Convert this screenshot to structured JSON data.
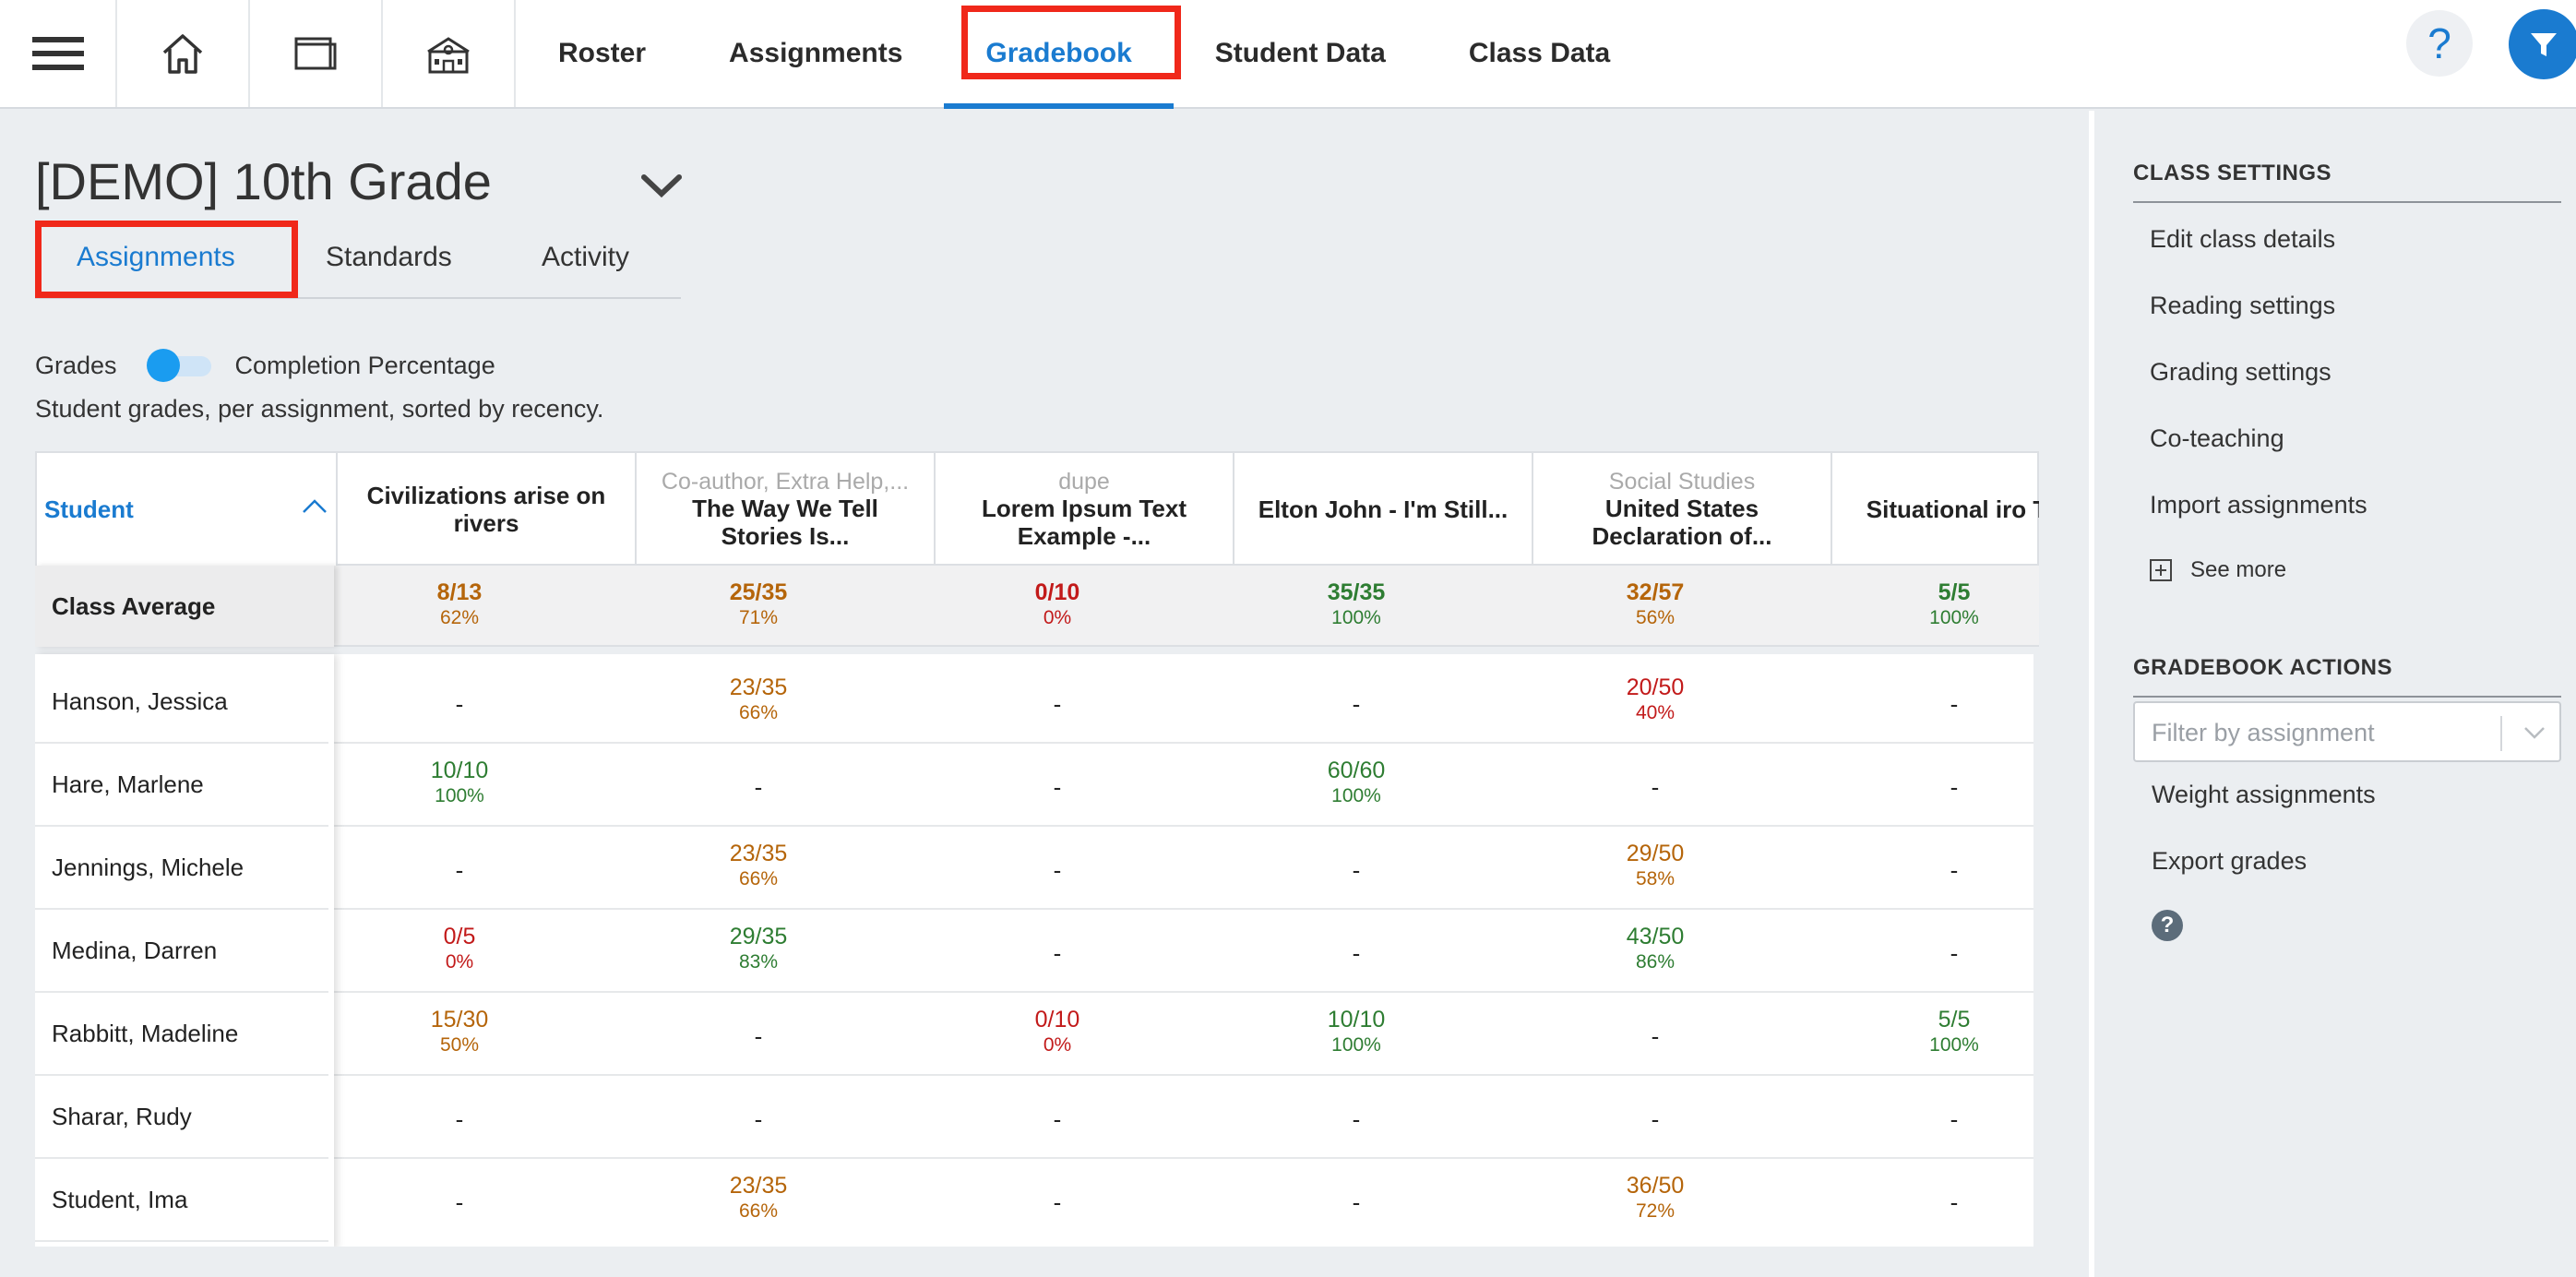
{
  "nav": {
    "links": [
      "Roster",
      "Assignments",
      "Gradebook",
      "Student Data",
      "Class Data"
    ],
    "active": "Gradebook",
    "help_label": "?"
  },
  "class": {
    "title": "[DEMO] 10th Grade",
    "tabs": [
      "Assignments",
      "Standards",
      "Activity"
    ],
    "active_tab": "Assignments"
  },
  "toggle": {
    "left_label": "Grades",
    "right_label": "Completion Percentage"
  },
  "description": "Student grades, per assignment, sorted by recency.",
  "table": {
    "student_header": "Student",
    "class_average_label": "Class Average",
    "columns": [
      {
        "category": "",
        "title": "Civilizations arise on rivers"
      },
      {
        "category": "Co-author, Extra Help,...",
        "title": "The Way We Tell Stories Is..."
      },
      {
        "category": "dupe",
        "title": "Lorem Ipsum Text Example -..."
      },
      {
        "category": "",
        "title": "Elton John - I'm Still..."
      },
      {
        "category": "Social Studies",
        "title": "United States Declaration of..."
      },
      {
        "category": "",
        "title": "Situational iro The..."
      }
    ],
    "averages": [
      {
        "score": "8/13",
        "pct": "62%",
        "color": "orange"
      },
      {
        "score": "25/35",
        "pct": "71%",
        "color": "orange"
      },
      {
        "score": "0/10",
        "pct": "0%",
        "color": "red"
      },
      {
        "score": "35/35",
        "pct": "100%",
        "color": "green"
      },
      {
        "score": "32/57",
        "pct": "56%",
        "color": "orange"
      },
      {
        "score": "5/5",
        "pct": "100%",
        "color": "green"
      }
    ],
    "rows": [
      {
        "name": "Hanson, Jessica",
        "cells": [
          {
            "score": "-"
          },
          {
            "score": "23/35",
            "pct": "66%",
            "color": "orange"
          },
          {
            "score": "-"
          },
          {
            "score": "-"
          },
          {
            "score": "20/50",
            "pct": "40%",
            "color": "red"
          },
          {
            "score": "-"
          }
        ]
      },
      {
        "name": "Hare, Marlene",
        "cells": [
          {
            "score": "10/10",
            "pct": "100%",
            "color": "green"
          },
          {
            "score": "-"
          },
          {
            "score": "-"
          },
          {
            "score": "60/60",
            "pct": "100%",
            "color": "green"
          },
          {
            "score": "-"
          },
          {
            "score": "-"
          }
        ]
      },
      {
        "name": "Jennings, Michele",
        "cells": [
          {
            "score": "-"
          },
          {
            "score": "23/35",
            "pct": "66%",
            "color": "orange"
          },
          {
            "score": "-"
          },
          {
            "score": "-"
          },
          {
            "score": "29/50",
            "pct": "58%",
            "color": "orange"
          },
          {
            "score": "-"
          }
        ]
      },
      {
        "name": "Medina, Darren",
        "cells": [
          {
            "score": "0/5",
            "pct": "0%",
            "color": "red"
          },
          {
            "score": "29/35",
            "pct": "83%",
            "color": "green"
          },
          {
            "score": "-"
          },
          {
            "score": "-"
          },
          {
            "score": "43/50",
            "pct": "86%",
            "color": "green"
          },
          {
            "score": "-"
          }
        ]
      },
      {
        "name": "Rabbitt, Madeline",
        "cells": [
          {
            "score": "15/30",
            "pct": "50%",
            "color": "orange"
          },
          {
            "score": "-"
          },
          {
            "score": "0/10",
            "pct": "0%",
            "color": "red"
          },
          {
            "score": "10/10",
            "pct": "100%",
            "color": "green"
          },
          {
            "score": "-"
          },
          {
            "score": "5/5",
            "pct": "100%",
            "color": "green"
          }
        ]
      },
      {
        "name": "Sharar, Rudy",
        "cells": [
          {
            "score": "-"
          },
          {
            "score": "-"
          },
          {
            "score": "-"
          },
          {
            "score": "-"
          },
          {
            "score": "-"
          },
          {
            "score": "-"
          }
        ]
      },
      {
        "name": "Student, Ima",
        "cells": [
          {
            "score": "-"
          },
          {
            "score": "23/35",
            "pct": "66%",
            "color": "orange"
          },
          {
            "score": "-"
          },
          {
            "score": "-"
          },
          {
            "score": "36/50",
            "pct": "72%",
            "color": "orange"
          },
          {
            "score": "-"
          }
        ]
      }
    ]
  },
  "right_panel": {
    "class_settings_heading": "CLASS SETTINGS",
    "class_settings": [
      "Edit class details",
      "Reading settings",
      "Grading settings",
      "Co-teaching",
      "Import assignments"
    ],
    "see_more": "See more",
    "gradebook_actions_heading": "GRADEBOOK ACTIONS",
    "filter_placeholder": "Filter by assignment",
    "actions": [
      "Weight assignments",
      "Export grades"
    ],
    "help_label": "?"
  },
  "colors": {
    "accent": "#1a7bd0",
    "highlight": "#f0281a",
    "orange": "#b5650a",
    "green": "#2e7d32",
    "red": "#c21a1a"
  }
}
